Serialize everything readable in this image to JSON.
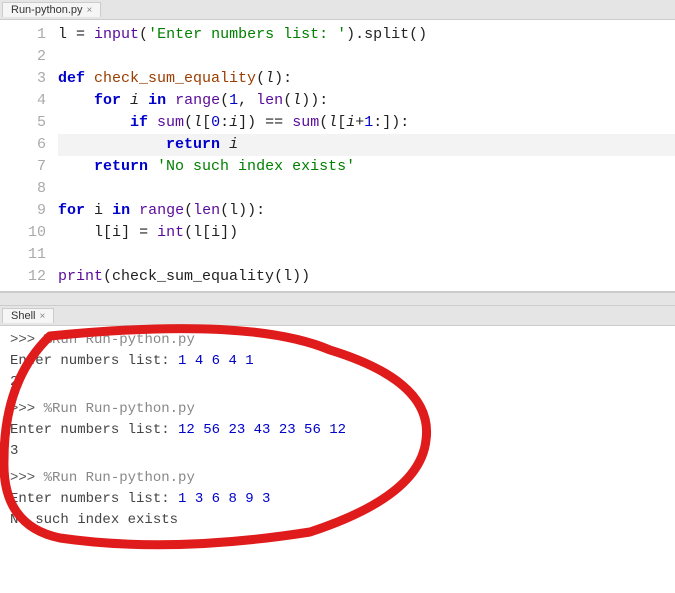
{
  "editor": {
    "tab_label": "Run-python.py",
    "lines": {
      "l1_var": "l",
      "l1_assign": " = ",
      "l1_input": "input",
      "l1_str": "'Enter numbers list: '",
      "l1_split": ".split",
      "l3_def": "def",
      "l3_fname": "check_sum_equality",
      "l3_param": "l",
      "l4_for": "for",
      "l4_i": "i",
      "l4_in": "in",
      "l4_range": "range",
      "l4_one": "1",
      "l4_len": "len",
      "l5_if": "if",
      "l5_sum": "sum",
      "l5_zero": "0",
      "l5_eq": " == ",
      "l5_plus": "+",
      "l5_one": "1",
      "l6_return": "return",
      "l7_return": "return",
      "l7_str": "'No such index exists'",
      "l9_for": "for",
      "l9_i": "i",
      "l9_in": "in",
      "l9_range": "range",
      "l9_len": "len",
      "l9_l": "l",
      "l10_int": "int",
      "l12_print": "print",
      "l12_fname": "check_sum_equality"
    },
    "line_numbers": [
      "1",
      "2",
      "3",
      "4",
      "5",
      "6",
      "7",
      "8",
      "9",
      "10",
      "11",
      "12"
    ]
  },
  "shell": {
    "tab_label": "Shell",
    "prompt_arrows": ">>>",
    "run_cmd": "%Run Run-python.py",
    "prompt_text": "Enter numbers list: ",
    "runs": [
      {
        "input": "1 4 6 4 1",
        "output": "2"
      },
      {
        "input": "12 56 23 43 23 56 12",
        "output": "3"
      },
      {
        "input": "1 3 6 8 9 3",
        "output": "No such index exists"
      }
    ]
  }
}
